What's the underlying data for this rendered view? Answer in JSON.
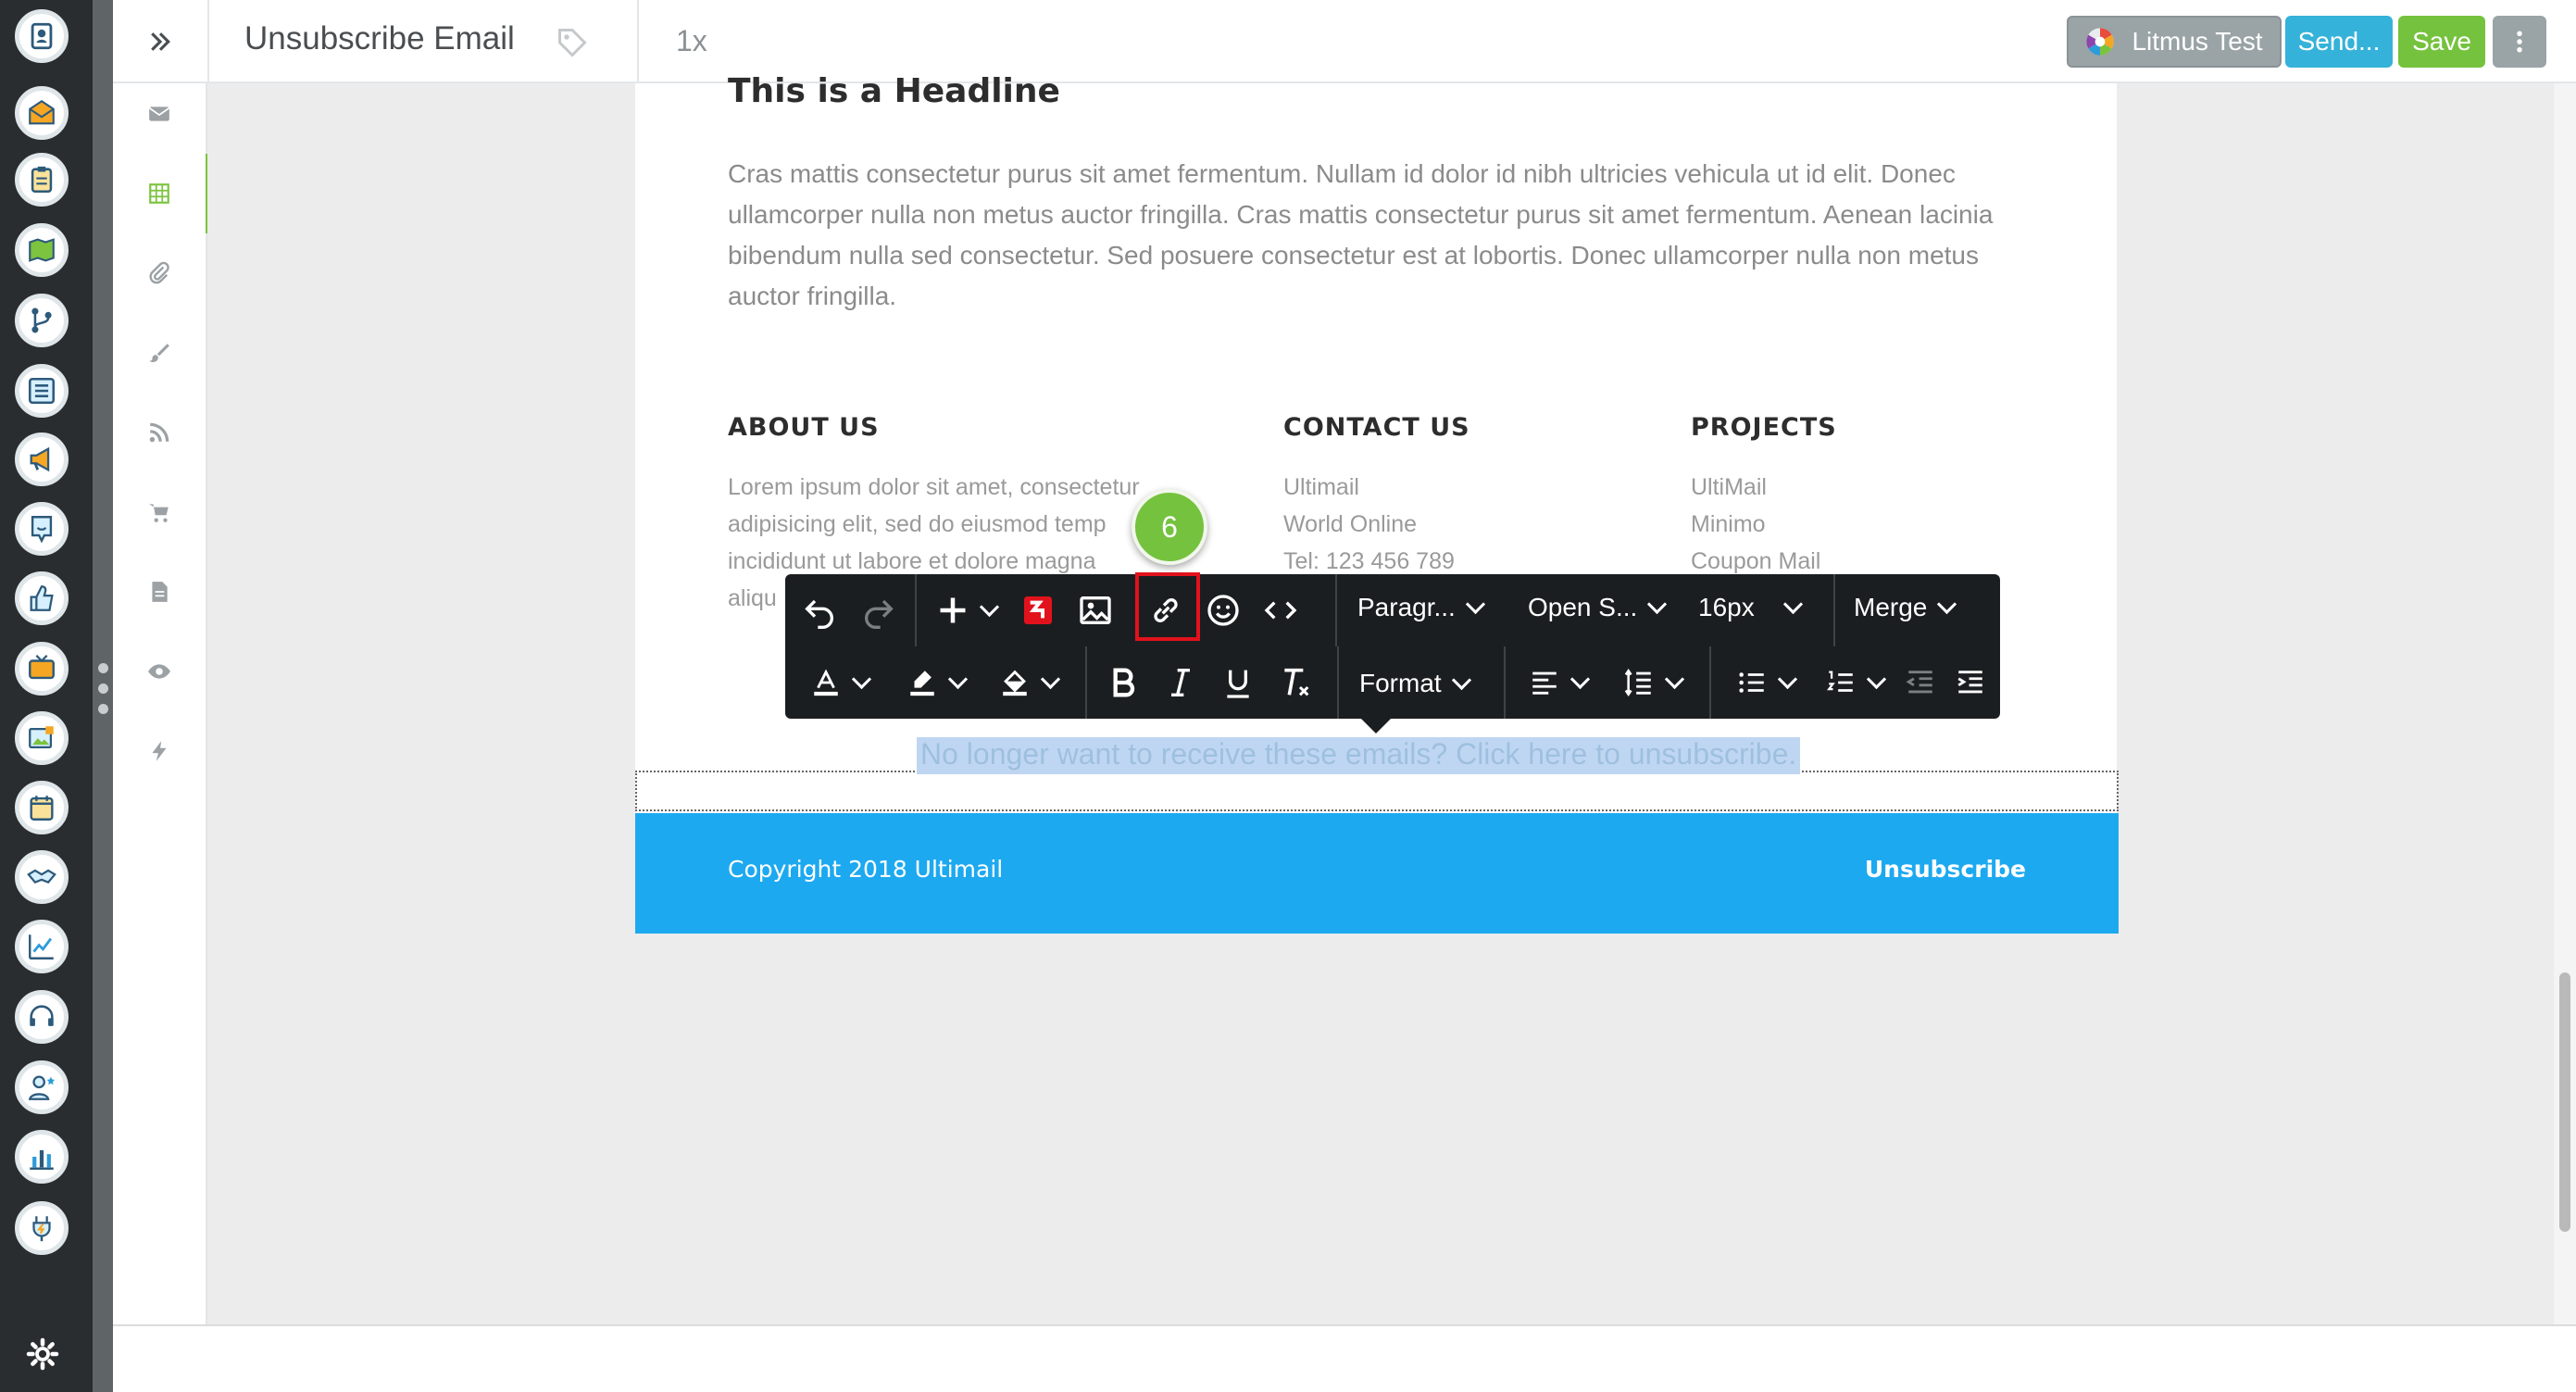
{
  "header": {
    "title": "Unsubscribe Email",
    "zoom": "1x",
    "litmus_label": "Litmus Test",
    "send_label": "Send...",
    "save_label": "Save"
  },
  "rail": {
    "items": [
      "contacts-icon",
      "email-icon",
      "clipboard-icon",
      "map-icon",
      "workflow-icon",
      "list-icon",
      "megaphone-icon",
      "chat-icon",
      "thumbs-up-icon",
      "tv-icon",
      "image-icon",
      "calendar-icon",
      "handshake-icon",
      "chart-line-icon",
      "headset-icon",
      "user-star-icon",
      "bar-chart-icon",
      "plug-icon"
    ],
    "settings_icon": "gear-icon"
  },
  "sidebar": {
    "items": [
      "envelope-icon",
      "layout-icon",
      "paperclip-icon",
      "brush-icon",
      "rss-icon",
      "cart-icon",
      "document-icon",
      "eye-icon",
      "lightning-icon"
    ],
    "active_index": 1
  },
  "email": {
    "headline": "This is a Headline",
    "body": "Cras mattis consectetur purus sit amet fermentum. Nullam id dolor id nibh ultricies vehicula ut id elit. Donec ullamcorper nulla non metus auctor fringilla. Cras mattis consectetur purus sit amet fermentum. Aenean lacinia bibendum nulla sed consectetur. Sed posuere consectetur est at lobortis. Donec ullamcorper nulla non metus auctor fringilla.",
    "about": {
      "heading": "ABOUT US",
      "line1": "Lorem ipsum dolor sit amet, consectetur",
      "line2": "adipisicing elit, sed do eiusmod temp",
      "line3": "incididunt ut labore et dolore magna",
      "line4": "aliqu"
    },
    "contact": {
      "heading": "CONTACT US",
      "line1": "Ultimail",
      "line2": "World Online",
      "line3": "Tel: 123 456 789"
    },
    "projects": {
      "heading": "PROJECTS",
      "line1": "UltiMail",
      "line2": "Minimo",
      "line3": "Coupon Mail"
    },
    "unsubscribe_text": "No longer want to receive these emails? Click here to unsubscribe.",
    "footer": {
      "copyright": "Copyright 2018 Ultimail",
      "unsubscribe": "Unsubscribe"
    }
  },
  "toolbar": {
    "paragraph": "Paragr...",
    "font": "Open S...",
    "size": "16px",
    "merge": "Merge",
    "format": "Format"
  },
  "callout": {
    "step": "6"
  },
  "colors": {
    "rail": "#2a2d2f",
    "accent_green": "#75c23e",
    "send_blue": "#35b2d9",
    "footer_blue": "#1da9f0",
    "highlight_red": "#e1121c"
  }
}
